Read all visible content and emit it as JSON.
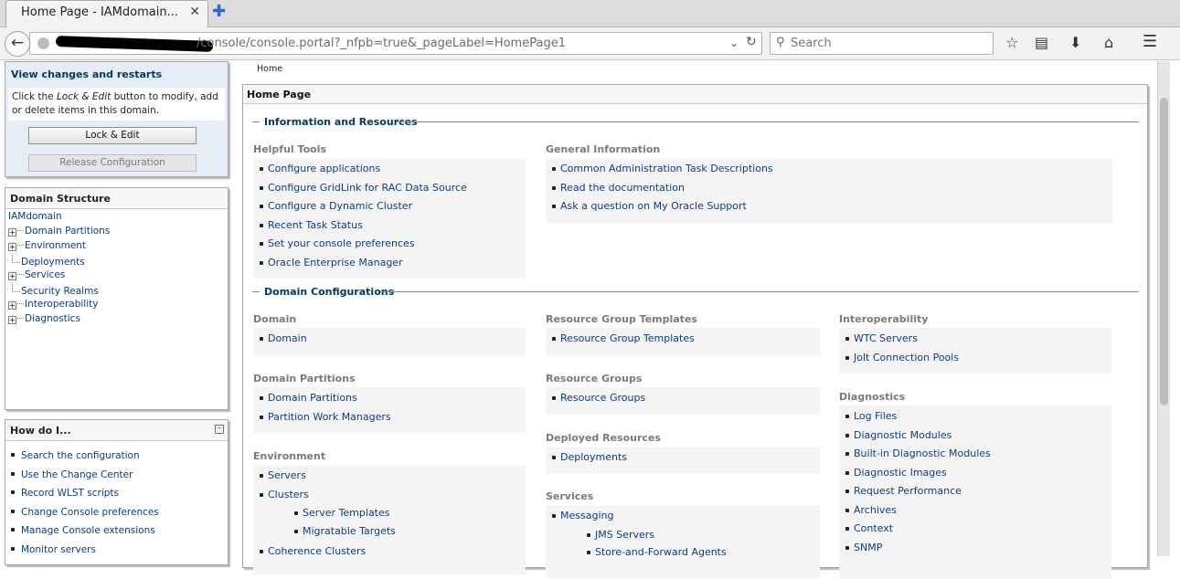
{
  "browser": {
    "tab_title": "Home Page - IAMdomain...",
    "tab_close": "✕",
    "new_tab": "✚",
    "url": "/console/console.portal?_nfpb=true&_pageLabel=HomePage1",
    "search_placeholder": "Search",
    "icons": [
      "back-arrow-icon",
      "globe-icon",
      "reload-icon",
      "search-icon",
      "bookmark-star-icon",
      "reading-list-icon",
      "download-icon",
      "home-icon",
      "menu-icon"
    ]
  },
  "change_center": {
    "title": "View changes and restarts",
    "desc_pre": "Click the ",
    "desc_em": "Lock & Edit",
    "desc_post": " button to modify, add or delete items in this domain.",
    "lock_button": "Lock & Edit",
    "release_button": "Release Configuration"
  },
  "domain_structure": {
    "title": "Domain Structure",
    "root": "IAMdomain",
    "items": [
      {
        "label": "Domain Partitions",
        "expandable": true
      },
      {
        "label": "Environment",
        "expandable": true
      },
      {
        "label": "Deployments",
        "expandable": false
      },
      {
        "label": "Services",
        "expandable": true
      },
      {
        "label": "Security Realms",
        "expandable": false
      },
      {
        "label": "Interoperability",
        "expandable": true
      },
      {
        "label": "Diagnostics",
        "expandable": true
      }
    ]
  },
  "how_do_i": {
    "title": "How do I...",
    "items": [
      "Search the configuration",
      "Use the Change Center",
      "Record WLST scripts",
      "Change Console preferences",
      "Manage Console extensions",
      "Monitor servers"
    ]
  },
  "breadcrumb": "Home",
  "main": {
    "title": "Home Page",
    "section_info": "Information and Resources",
    "helpful_tools": {
      "title": "Helpful Tools",
      "items": [
        "Configure applications",
        "Configure GridLink for RAC Data Source",
        "Configure a Dynamic Cluster",
        "Recent Task Status",
        "Set your console preferences",
        "Oracle Enterprise Manager"
      ]
    },
    "general_info": {
      "title": "General Information",
      "items": [
        "Common Administration Task Descriptions",
        "Read the documentation",
        "Ask a question on My Oracle Support"
      ]
    },
    "section_domain": "Domain Configurations",
    "domain": {
      "title": "Domain",
      "items": [
        "Domain"
      ]
    },
    "domain_partitions": {
      "title": "Domain Partitions",
      "items": [
        "Domain Partitions",
        "Partition Work Managers"
      ]
    },
    "environment": {
      "title": "Environment",
      "items": [
        "Servers",
        "Clusters"
      ],
      "sub_items": [
        "Server Templates",
        "Migratable Targets"
      ],
      "after": [
        "Coherence Clusters"
      ]
    },
    "rg_templates": {
      "title": "Resource Group Templates",
      "items": [
        "Resource Group Templates"
      ]
    },
    "resource_groups": {
      "title": "Resource Groups",
      "items": [
        "Resource Groups"
      ]
    },
    "deployed_resources": {
      "title": "Deployed Resources",
      "items": [
        "Deployments"
      ]
    },
    "services": {
      "title": "Services",
      "items": [
        "Messaging"
      ],
      "sub_items": [
        "JMS Servers",
        "Store-and-Forward Agents"
      ]
    },
    "interoperability": {
      "title": "Interoperability",
      "items": [
        "WTC Servers",
        "Jolt Connection Pools"
      ]
    },
    "diagnostics": {
      "title": "Diagnostics",
      "items": [
        "Log Files",
        "Diagnostic Modules",
        "Built-in Diagnostic Modules",
        "Diagnostic Images",
        "Request Performance",
        "Archives",
        "Context",
        "SNMP"
      ]
    }
  }
}
